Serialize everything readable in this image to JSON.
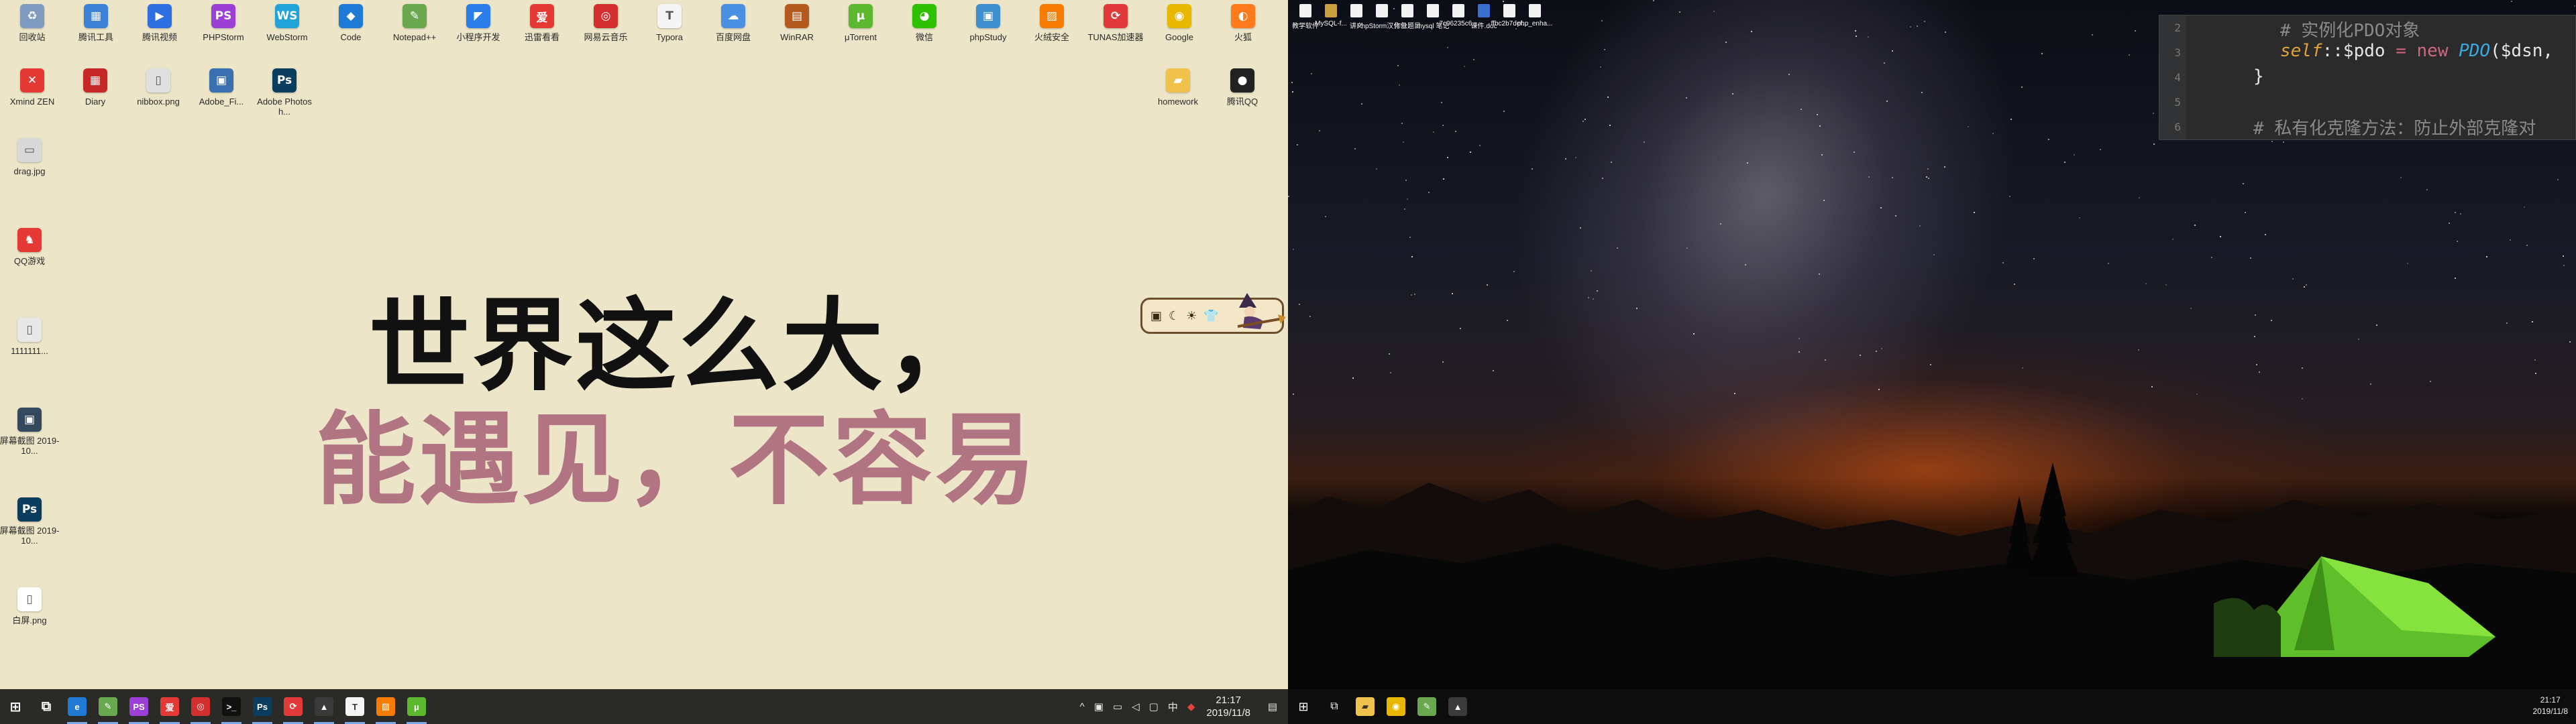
{
  "left_desktop": {
    "icons_row1": [
      {
        "label": "回收站",
        "icon": "recycle-bin-icon",
        "color": "#7f9bbf",
        "glyph": "♻"
      },
      {
        "label": "腾讯工具",
        "icon": "tools-icon",
        "color": "#3b82d6",
        "glyph": "▦"
      },
      {
        "label": "腾讯视频",
        "icon": "video-icon",
        "color": "#2d6fe0",
        "glyph": "▶"
      },
      {
        "label": "PHPStorm",
        "icon": "phpstorm-icon",
        "color": "#9b3fd6",
        "glyph": "PS"
      },
      {
        "label": "WebStorm",
        "icon": "webstorm-icon",
        "color": "#1fa3d8",
        "glyph": "WS"
      },
      {
        "label": "Code",
        "icon": "vscode-icon",
        "color": "#1f7ad6",
        "glyph": "◆"
      },
      {
        "label": "Notepad++",
        "icon": "notepad-icon",
        "color": "#6aa84f",
        "glyph": "✎"
      },
      {
        "label": "小程序开发",
        "icon": "devtools-icon",
        "color": "#2b7de9",
        "glyph": "◤"
      },
      {
        "label": "迅雷看看",
        "icon": "video-red-icon",
        "color": "#e53935",
        "glyph": "爱"
      },
      {
        "label": "网易云音乐",
        "icon": "music-icon",
        "color": "#d32f2f",
        "glyph": "◎"
      },
      {
        "label": "Typora",
        "icon": "typora-icon",
        "color": "#f5f5f5",
        "glyph": "T"
      },
      {
        "label": "百度网盘",
        "icon": "cloud-icon",
        "color": "#4a90e2",
        "glyph": "☁"
      },
      {
        "label": "WinRAR",
        "icon": "archive-icon",
        "color": "#b45a1f",
        "glyph": "▤"
      },
      {
        "label": "μTorrent",
        "icon": "torrent-icon",
        "color": "#5cb82e",
        "glyph": "μ"
      },
      {
        "label": "微信",
        "icon": "wechat-icon",
        "color": "#2dc100",
        "glyph": "◕"
      },
      {
        "label": "phpStudy",
        "icon": "phpstudy-icon",
        "color": "#3e8ed0",
        "glyph": "▣"
      },
      {
        "label": "火绒安全",
        "icon": "security-icon",
        "color": "#f57c00",
        "glyph": "▨"
      },
      {
        "label": "TUNAS加速器",
        "icon": "accelerator-icon",
        "color": "#e03a3a",
        "glyph": "⟳"
      },
      {
        "label": "Google",
        "icon": "chrome-icon",
        "color": "#e8b800",
        "glyph": "◉"
      },
      {
        "label": "火狐",
        "icon": "firefox-icon",
        "color": "#ff7a1a",
        "glyph": "◐"
      }
    ],
    "icons_row2": [
      {
        "label": "Xmind ZEN",
        "icon": "xmind-icon",
        "color": "#e53935",
        "glyph": "✕"
      },
      {
        "label": "Diary",
        "icon": "calendar-icon",
        "color": "#c62828",
        "glyph": "▦"
      },
      {
        "label": "nibbox.png",
        "icon": "image-file-icon",
        "color": "#e0e0e0",
        "glyph": "▯"
      },
      {
        "label": "Adobe_Fi...",
        "icon": "installer-icon",
        "color": "#3a6fb0",
        "glyph": "▣"
      },
      {
        "label": "Adobe Photosh...",
        "icon": "photoshop-icon",
        "color": "#0b3d5e",
        "glyph": "Ps"
      }
    ],
    "icons_col": [
      {
        "label": "drag.jpg",
        "icon": "jpg-file-icon",
        "color": "#d8d8d8",
        "glyph": "▭"
      },
      {
        "label": "QQ游戏",
        "icon": "game-icon",
        "color": "#e53935",
        "glyph": "♞"
      },
      {
        "label": "1111111...",
        "icon": "file-icon",
        "color": "#e8e8e8",
        "glyph": "▯"
      },
      {
        "label": "屏幕截图 2019-10...",
        "icon": "screenshot-icon",
        "color": "#34495e",
        "glyph": "▣"
      },
      {
        "label": "屏幕截图 2019-10...",
        "icon": "screenshot-ps-icon",
        "color": "#0b3d5e",
        "glyph": "Ps"
      },
      {
        "label": "白屏.png",
        "icon": "png-file-icon",
        "color": "#ffffff",
        "glyph": "▯"
      }
    ],
    "icons_right": [
      {
        "label": "homework",
        "icon": "folder-icon",
        "color": "#f0c24b",
        "glyph": "▰"
      },
      {
        "label": "腾讯QQ",
        "icon": "qq-icon",
        "color": "#222222",
        "glyph": "●"
      }
    ],
    "slogan": {
      "line1": "世界这么大，",
      "line2": "能遇见，不容易",
      "line1_color": "#111111",
      "line2_color": "#b07482"
    },
    "widget": {
      "items": [
        "▣",
        "☾",
        "☀",
        "👕"
      ]
    }
  },
  "left_taskbar": {
    "apps": [
      {
        "name": "start-button",
        "glyph": "⊞",
        "color": "transparent"
      },
      {
        "name": "task-view-button",
        "glyph": "⧉",
        "color": "transparent"
      },
      {
        "name": "edge-app",
        "glyph": "e",
        "color": "#1f7ad6"
      },
      {
        "name": "notepad-app",
        "glyph": "✎",
        "color": "#6aa84f"
      },
      {
        "name": "phpstorm-app",
        "glyph": "PS",
        "color": "#9b3fd6"
      },
      {
        "name": "video-app",
        "glyph": "爱",
        "color": "#e53935"
      },
      {
        "name": "music-app",
        "glyph": "◎",
        "color": "#d32f2f"
      },
      {
        "name": "terminal-app",
        "glyph": ">_",
        "color": "#111111"
      },
      {
        "name": "photoshop-app",
        "glyph": "Ps",
        "color": "#0b3d5e"
      },
      {
        "name": "browser-app",
        "glyph": "⟳",
        "color": "#e03a3a"
      },
      {
        "name": "photos-app",
        "glyph": "▲",
        "color": "#3a3a3a"
      },
      {
        "name": "typora-app",
        "glyph": "T",
        "color": "#f5f5f5"
      },
      {
        "name": "firewall-app",
        "glyph": "▨",
        "color": "#f57c00"
      },
      {
        "name": "torrent-app",
        "glyph": "μ",
        "color": "#5cb82e"
      }
    ],
    "tray": {
      "chevron": "^",
      "ime": "中",
      "time": "21:17",
      "date": "2019/11/8",
      "notification": "▤"
    }
  },
  "right_desktop": {
    "icons": [
      {
        "label": "教学软件"
      },
      {
        "label": "MySQL-f..."
      },
      {
        "label": "讲义"
      },
      {
        "label": "PhpStorm汉化包"
      },
      {
        "label": "作业题目"
      },
      {
        "label": "mysql 笔记"
      },
      {
        "label": "7c06235c6..."
      },
      {
        "label": "课件.doc"
      },
      {
        "label": "ffbc2b7def..."
      },
      {
        "label": "php_enha..."
      }
    ],
    "code": {
      "line_numbers": [
        "2",
        "3",
        "4",
        "5",
        "6"
      ],
      "comment1": "# 实例化PDO对象",
      "self_kw": "self",
      "member": "::$pdo",
      "assign": " = ",
      "new_kw": "new",
      "cls": " PDO",
      "args": "($dsn,",
      "brace": "}",
      "comment2": "# 私有化克隆方法：防止外部克隆对"
    }
  },
  "right_taskbar": {
    "time": "21:17",
    "date": "2019/11/8"
  }
}
